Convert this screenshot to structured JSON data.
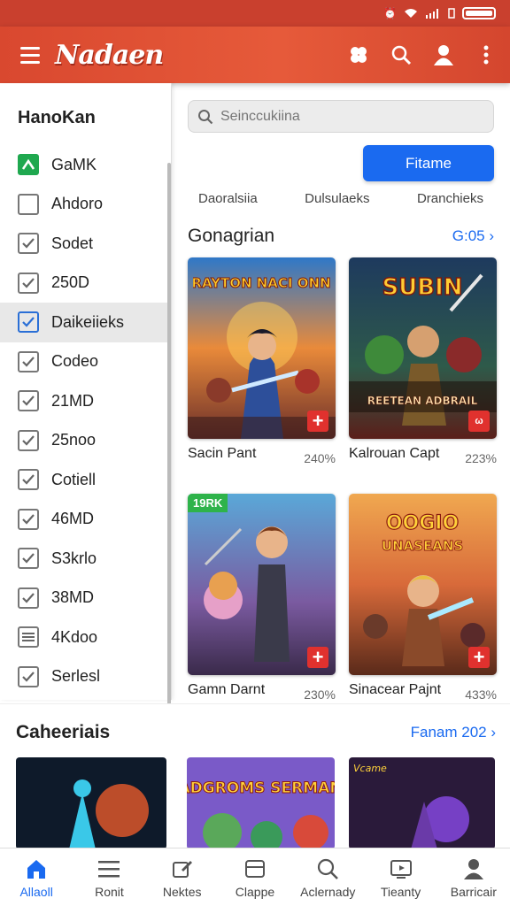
{
  "status_bar": {
    "icons": [
      "alarm-icon",
      "wifi-icon",
      "signal-icon",
      "battery-icon"
    ]
  },
  "app_bar": {
    "title": "Nadaen",
    "actions": [
      "puzzle-icon",
      "search-icon",
      "profile-icon",
      "more-vert-icon"
    ]
  },
  "sidebar": {
    "title": "HanoKan",
    "items": [
      {
        "label": "GaMK",
        "state": "green"
      },
      {
        "label": "Ahdoro",
        "state": "unchecked"
      },
      {
        "label": "Sodet",
        "state": "checked"
      },
      {
        "label": "250D",
        "state": "checked"
      },
      {
        "label": "Daikeiieks",
        "state": "checked-active"
      },
      {
        "label": "Codeo",
        "state": "checked"
      },
      {
        "label": "21MD",
        "state": "checked"
      },
      {
        "label": "25noo",
        "state": "checked"
      },
      {
        "label": "Cotiell",
        "state": "checked"
      },
      {
        "label": "46MD",
        "state": "checked"
      },
      {
        "label": "S3krlo",
        "state": "checked"
      },
      {
        "label": "38MD",
        "state": "checked"
      },
      {
        "label": "4Kdoo",
        "state": "list"
      },
      {
        "label": "Serlesl",
        "state": "checked"
      }
    ]
  },
  "search": {
    "placeholder": "Seinccukiina"
  },
  "primary_button": {
    "label": "Fitame"
  },
  "filter_tabs": [
    "Daoralsiia",
    "Dulsulaeks",
    "Dranchieks"
  ],
  "section_games": {
    "title": "Gonagrian",
    "link": "G:05 ›",
    "cards": [
      {
        "name": "Sacin Pant",
        "percent": "240%",
        "art_text": "RAYTON NACI ONN",
        "badge": ""
      },
      {
        "name": "Kalrouan Capt",
        "percent": "223%",
        "art_text": "SUBIN",
        "art_sub": "REETEAN ADBRAIL",
        "badge": ""
      },
      {
        "name": "Gamn Darnt",
        "percent": "230%",
        "art_text": "",
        "badge": "19RK"
      },
      {
        "name": "Sinacear Pajnt",
        "percent": "433%",
        "art_text": "OOGIO",
        "art_sub": "UNASEANS",
        "badge": ""
      }
    ]
  },
  "section_bottom": {
    "title": "Caheeriais",
    "link": "Fanam 202 ›",
    "cards": [
      {
        "art_text": ""
      },
      {
        "art_text": "ADGROMS SERMAN"
      },
      {
        "art_text": "Vcame"
      }
    ]
  },
  "bottom_nav": [
    {
      "label": "Allaoll",
      "icon": "home-icon"
    },
    {
      "label": "Ronit",
      "icon": "menu-icon"
    },
    {
      "label": "Nektes",
      "icon": "edit-icon"
    },
    {
      "label": "Clappe",
      "icon": "archive-icon"
    },
    {
      "label": "Aclernady",
      "icon": "search-icon"
    },
    {
      "label": "Tieanty",
      "icon": "media-icon"
    },
    {
      "label": "Barricair",
      "icon": "person-icon"
    }
  ],
  "colors": {
    "accent": "#1a6af0",
    "brand": "#d9482f",
    "add_red": "#e0312e",
    "green": "#2eb34a"
  }
}
